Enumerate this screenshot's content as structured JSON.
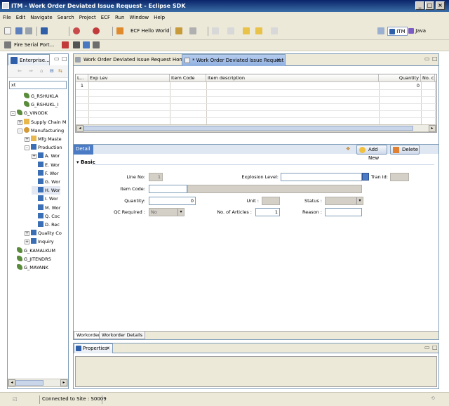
{
  "window": {
    "title": "ITM - Work Order Deviated Issue Request - Eclipse SDK",
    "controls": [
      "_",
      "□",
      "×"
    ]
  },
  "menu": [
    "File",
    "Edit",
    "Navigate",
    "Search",
    "Project",
    "ECF",
    "Run",
    "Window",
    "Help"
  ],
  "toolbar": {
    "ecf_hello": "ECF Hello World",
    "fire_serial": "Fire Serial Port...",
    "perspectives": [
      "ITM",
      "Java"
    ]
  },
  "left_view": {
    "tab": "Enterprise...",
    "filter_value": "xt",
    "tree": [
      {
        "label": "G_RSHUKLA",
        "level": 1,
        "icon": "user"
      },
      {
        "label": "G_RSHUKL_I",
        "level": 1,
        "icon": "user"
      },
      {
        "label": "G_VINODK",
        "level": 0,
        "icon": "user",
        "exp": "-"
      },
      {
        "label": "Supply Chain M",
        "level": 1,
        "icon": "folder",
        "exp": "+"
      },
      {
        "label": "Manufacturing",
        "level": 1,
        "icon": "gear",
        "exp": "-"
      },
      {
        "label": "Mfg Maste",
        "level": 2,
        "icon": "folder",
        "exp": "+"
      },
      {
        "label": "Production",
        "level": 2,
        "icon": "mod",
        "exp": "-"
      },
      {
        "label": "A. Wor",
        "level": 3,
        "icon": "mod",
        "exp": "+"
      },
      {
        "label": "E. Wor",
        "level": 3,
        "icon": "mod"
      },
      {
        "label": "F. Wor",
        "level": 3,
        "icon": "mod"
      },
      {
        "label": "G. Wor",
        "level": 3,
        "icon": "mod"
      },
      {
        "label": "H. Wor",
        "level": 3,
        "icon": "mod",
        "selected": true
      },
      {
        "label": "I. Wor",
        "level": 3,
        "icon": "mod"
      },
      {
        "label": "M. Wor",
        "level": 3,
        "icon": "mod"
      },
      {
        "label": "Q. Coc",
        "level": 3,
        "icon": "mod"
      },
      {
        "label": "D. Rec",
        "level": 3,
        "icon": "mod"
      },
      {
        "label": "Quality Co",
        "level": 2,
        "icon": "mod",
        "exp": "+"
      },
      {
        "label": "Inquiry",
        "level": 2,
        "icon": "mod",
        "exp": "+"
      },
      {
        "label": "G_KAMALKUM",
        "level": 0,
        "icon": "user"
      },
      {
        "label": "G_JITENDRS",
        "level": 0,
        "icon": "user"
      },
      {
        "label": "G_MAYANK",
        "level": 0,
        "icon": "user"
      }
    ]
  },
  "editor": {
    "tabs": [
      {
        "label": "Work Order Deviated Issue Request Home",
        "active": false
      },
      {
        "label": "* Work Order Deviated Issue Request",
        "active": true
      }
    ],
    "close_glyph": "✕",
    "grid": {
      "columns": [
        "L...",
        "Exp Lev",
        "Item Code",
        "Item description",
        "Quantity",
        "No. c"
      ],
      "rows": [
        [
          "1",
          "",
          "",
          "",
          "0",
          ""
        ]
      ]
    },
    "detail": {
      "tab": "Detail 2",
      "add_new": "Add New",
      "delete": "Delete",
      "section": "Basic",
      "fields": {
        "line_no": {
          "label": "Line No:",
          "value": "1"
        },
        "explosion_level": {
          "label": "Explosion Level:",
          "value": ""
        },
        "tran_id": {
          "label": "Tran Id:",
          "value": ""
        },
        "item_code": {
          "label": "Item Code:",
          "value": ""
        },
        "quantity": {
          "label": "Quantity:",
          "value": "0"
        },
        "unit": {
          "label": "Unit :",
          "value": ""
        },
        "status": {
          "label": "Status :",
          "value": ""
        },
        "qc_required": {
          "label": "QC Required :",
          "value": "No"
        },
        "no_of_articles": {
          "label": "No. of Articles :",
          "value": "1"
        },
        "reason": {
          "label": "Reason :",
          "value": ""
        }
      }
    },
    "bottom_tabs": [
      "Workorder",
      "Workorder Details"
    ]
  },
  "properties_view": {
    "tab": "Properties",
    "close": "✕"
  },
  "status_bar": {
    "text": "Connected to Site : S0009"
  }
}
